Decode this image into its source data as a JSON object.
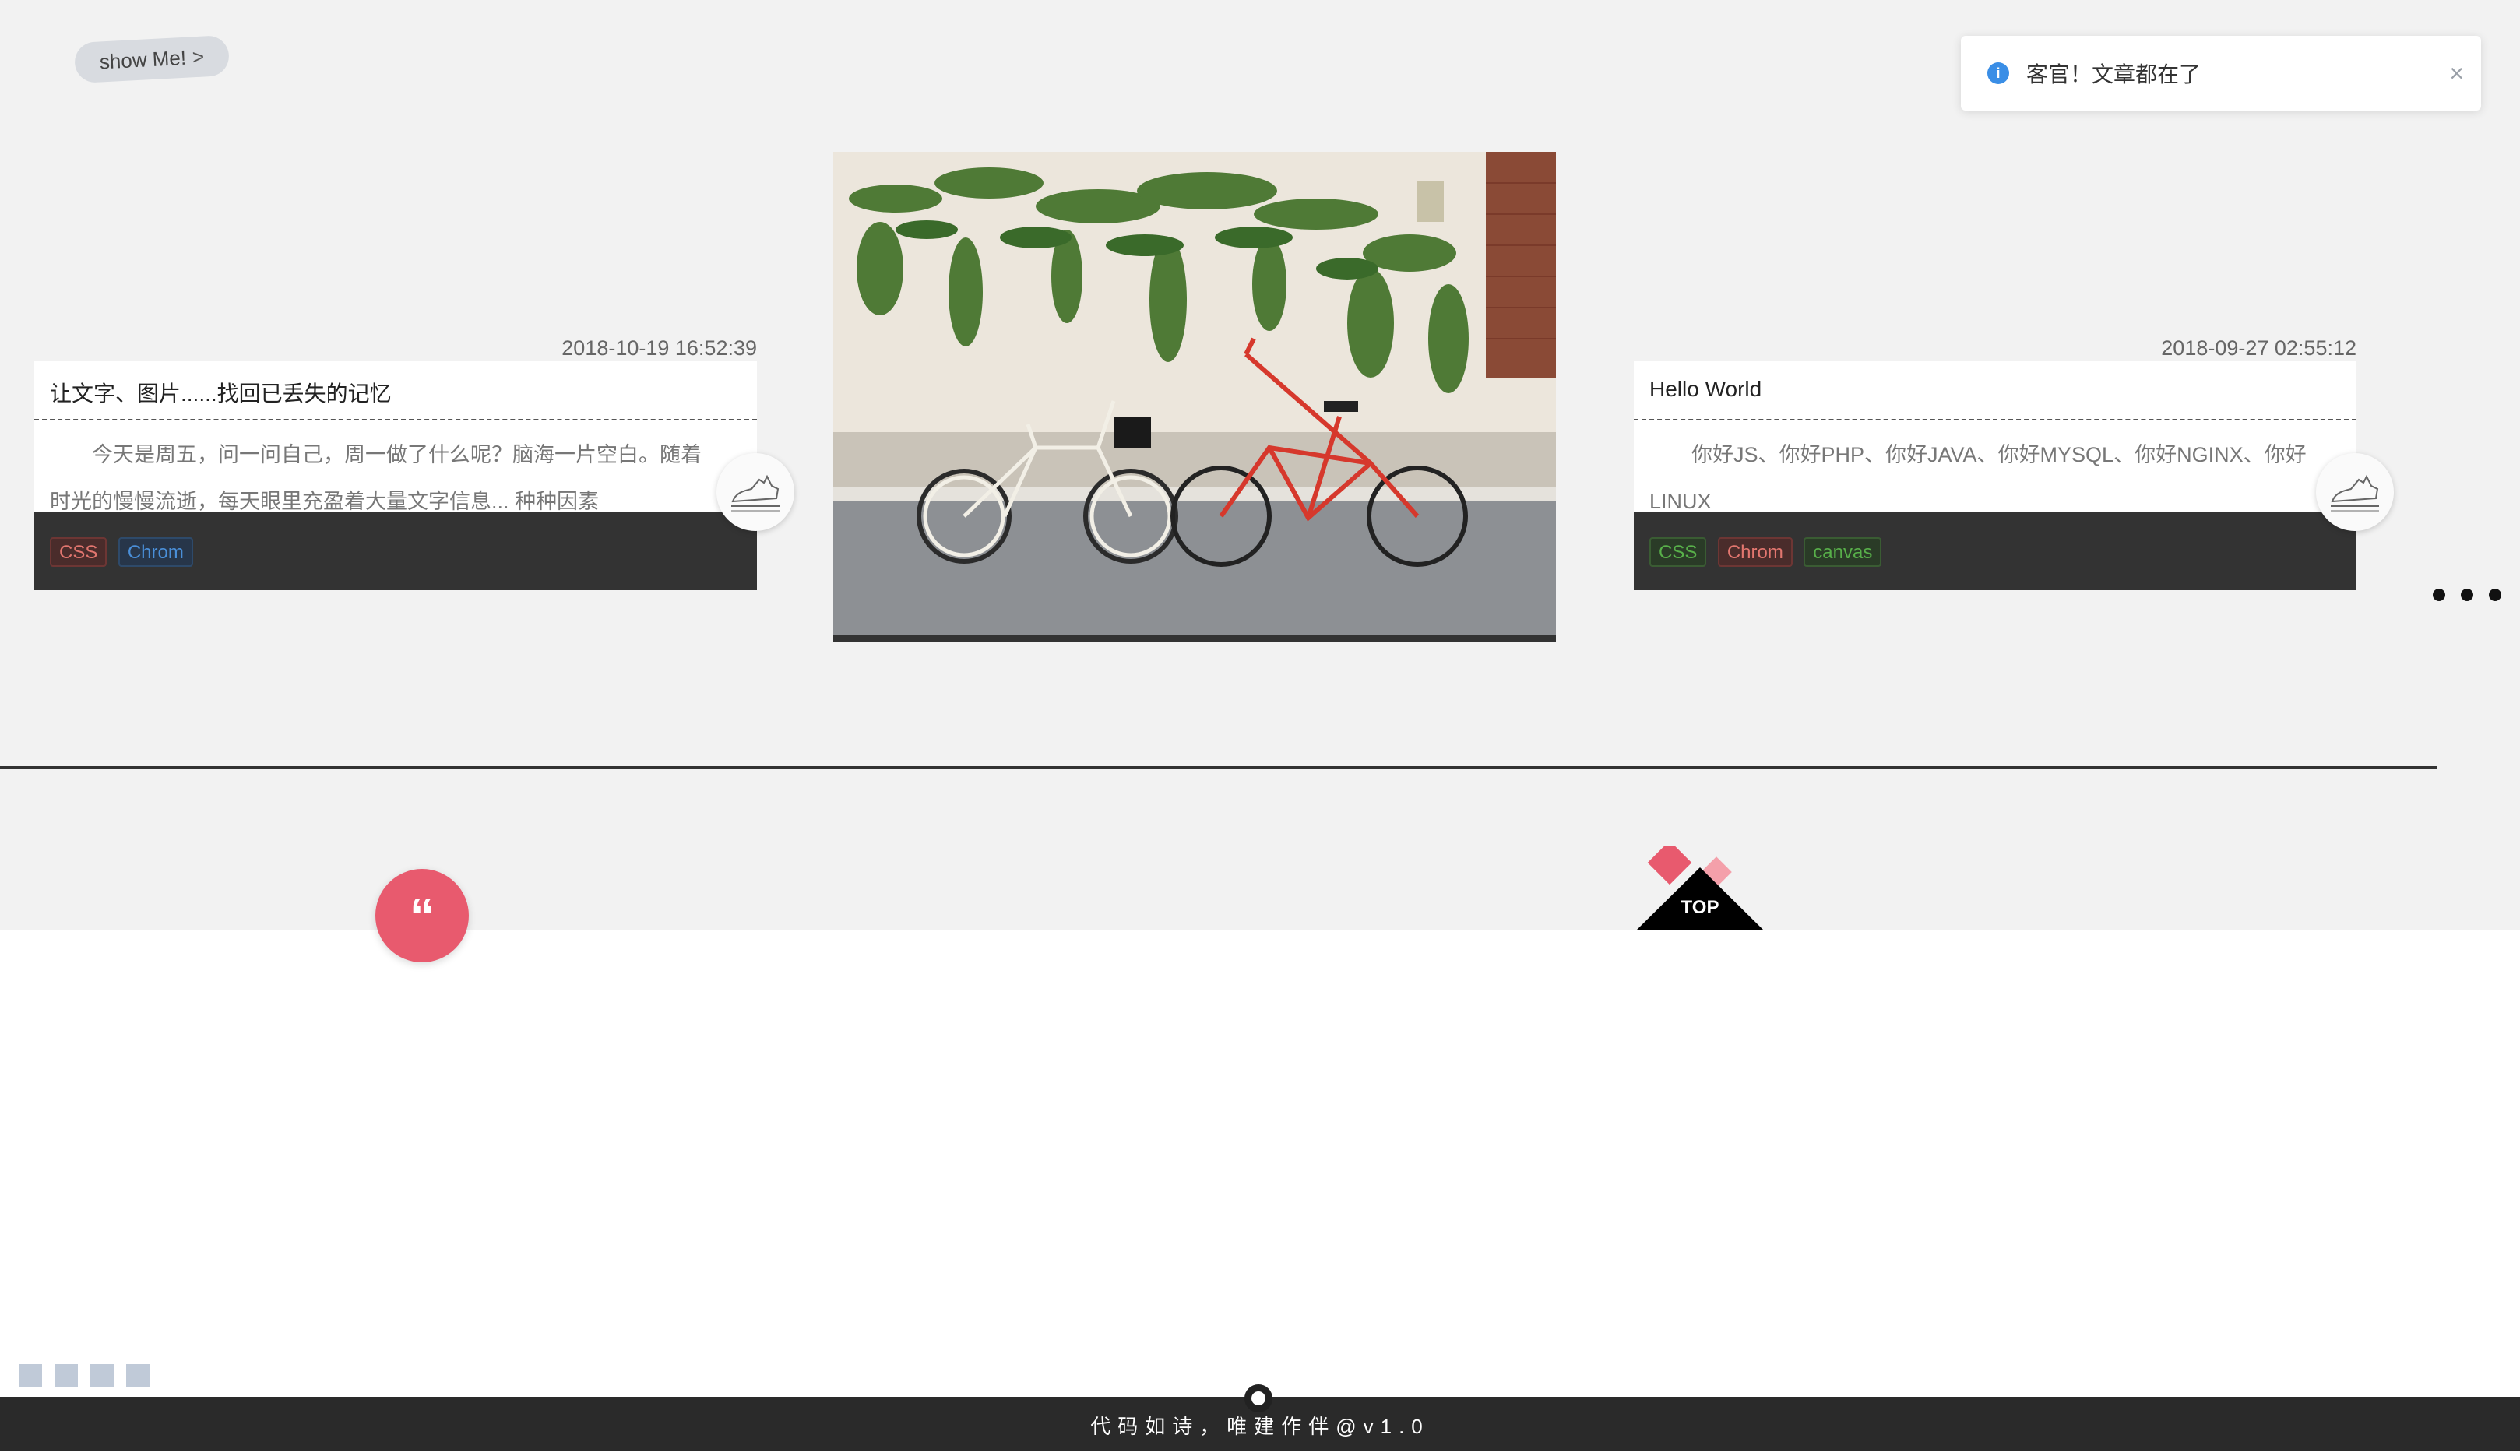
{
  "header": {
    "show_button_label": "show Me!",
    "show_button_chevron": ">"
  },
  "notification": {
    "message": "客官！文章都在了",
    "close": "×",
    "info": "i"
  },
  "cards": [
    {
      "date": "2018-10-19 16:52:39",
      "title": "让文字、图片......找回已丢失的记忆",
      "excerpt": "今天是周五，问一问自己，周一做了什么呢？脑海一片空白。随着时光的慢慢流逝，每天眼里充盈着大量文字信息... 种种因素",
      "tags": [
        "CSS",
        "Chrom"
      ]
    },
    {
      "date": "2018-09-27 02:55:12",
      "title": "Hello World",
      "excerpt": "你好JS、你好PHP、你好JAVA、你好MYSQL、你好NGINX、你好LINUX",
      "tags": [
        "CSS",
        "Chrom",
        "canvas"
      ]
    }
  ],
  "quote_button": "“",
  "top_button": "TOP",
  "footer": {
    "text": "代码如诗，唯建作伴@v1.0"
  },
  "colors": {
    "accent_pink": "#e85a6e",
    "info_blue": "#3a8ee6",
    "footer_bg": "#2a2a2a",
    "page_bg": "#f2f2f2"
  }
}
